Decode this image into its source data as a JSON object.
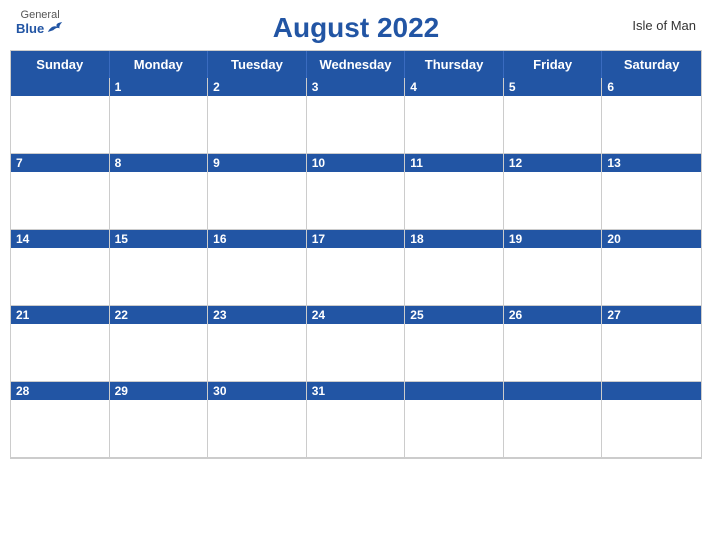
{
  "header": {
    "logo_general": "General",
    "logo_blue": "Blue",
    "title": "August 2022",
    "region": "Isle of Man"
  },
  "days": [
    "Sunday",
    "Monday",
    "Tuesday",
    "Wednesday",
    "Thursday",
    "Friday",
    "Saturday"
  ],
  "weeks": [
    [
      {
        "date": "",
        "empty": true
      },
      {
        "date": "1"
      },
      {
        "date": "2"
      },
      {
        "date": "3"
      },
      {
        "date": "4"
      },
      {
        "date": "5"
      },
      {
        "date": "6"
      }
    ],
    [
      {
        "date": "7"
      },
      {
        "date": "8"
      },
      {
        "date": "9"
      },
      {
        "date": "10"
      },
      {
        "date": "11"
      },
      {
        "date": "12"
      },
      {
        "date": "13"
      }
    ],
    [
      {
        "date": "14"
      },
      {
        "date": "15"
      },
      {
        "date": "16"
      },
      {
        "date": "17"
      },
      {
        "date": "18"
      },
      {
        "date": "19"
      },
      {
        "date": "20"
      }
    ],
    [
      {
        "date": "21"
      },
      {
        "date": "22"
      },
      {
        "date": "23"
      },
      {
        "date": "24"
      },
      {
        "date": "25"
      },
      {
        "date": "26"
      },
      {
        "date": "27"
      }
    ],
    [
      {
        "date": "28"
      },
      {
        "date": "29"
      },
      {
        "date": "30"
      },
      {
        "date": "31"
      },
      {
        "date": "",
        "empty": true
      },
      {
        "date": "",
        "empty": true
      },
      {
        "date": "",
        "empty": true
      }
    ]
  ]
}
